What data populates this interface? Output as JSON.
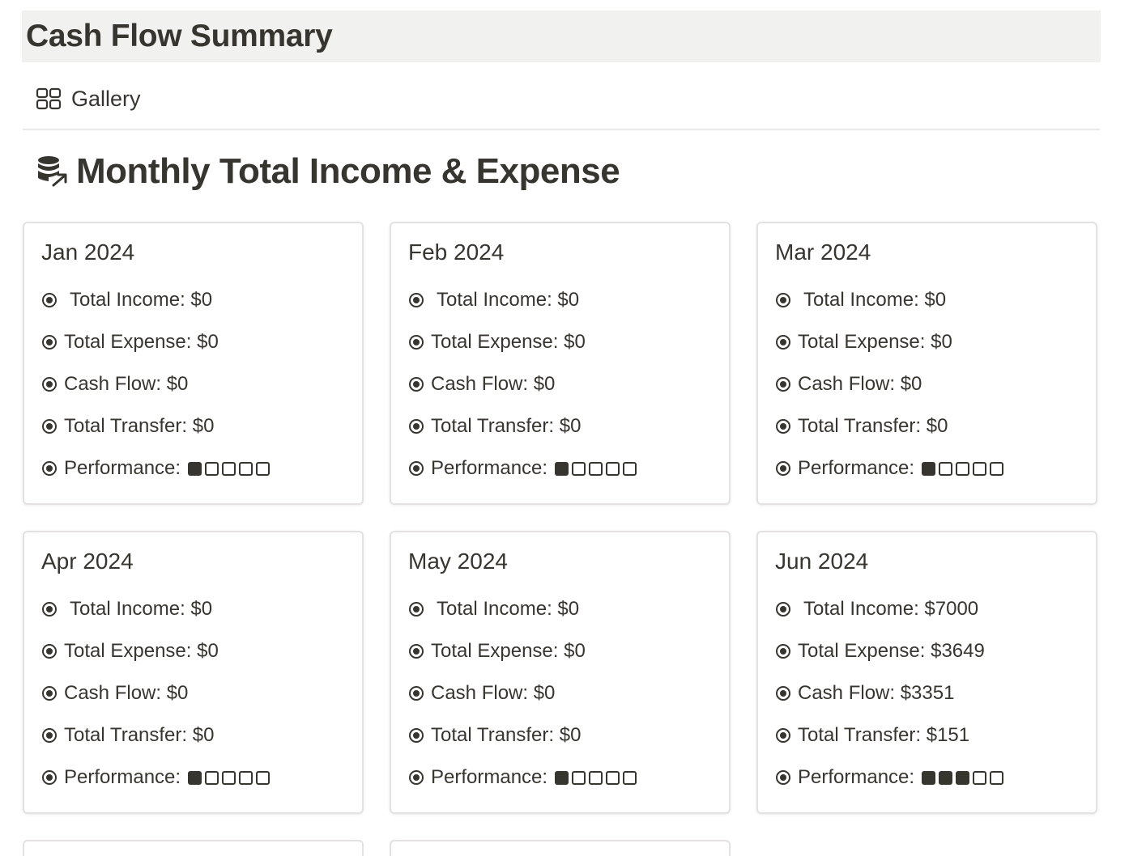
{
  "page": {
    "title": "Cash Flow Summary"
  },
  "view_tab": {
    "label": "Gallery",
    "icon": "gallery-grid-icon"
  },
  "section": {
    "title": "Monthly Total Income & Expense",
    "icon": "database-arrow-icon"
  },
  "field_labels": {
    "income": "Total Income: ",
    "expense": "Total Expense: ",
    "cash_flow": "Cash Flow: ",
    "transfer": "Total Transfer: ",
    "performance": "Performance:"
  },
  "cards": [
    {
      "title": "Jan 2024",
      "income": "$0",
      "expense": "$0",
      "cash_flow": "$0",
      "transfer": "$0",
      "performance_filled": 1,
      "performance_total": 5
    },
    {
      "title": "Feb 2024",
      "income": "$0",
      "expense": "$0",
      "cash_flow": "$0",
      "transfer": "$0",
      "performance_filled": 1,
      "performance_total": 5
    },
    {
      "title": "Mar 2024",
      "income": "$0",
      "expense": "$0",
      "cash_flow": "$0",
      "transfer": "$0",
      "performance_filled": 1,
      "performance_total": 5
    },
    {
      "title": "Apr 2024",
      "income": "$0",
      "expense": "$0",
      "cash_flow": "$0",
      "transfer": "$0",
      "performance_filled": 1,
      "performance_total": 5
    },
    {
      "title": "May 2024",
      "income": "$0",
      "expense": "$0",
      "cash_flow": "$0",
      "transfer": "$0",
      "performance_filled": 1,
      "performance_total": 5
    },
    {
      "title": "Jun 2024",
      "income": "$7000",
      "expense": "$3649",
      "cash_flow": "$3351",
      "transfer": "$151",
      "performance_filled": 3,
      "performance_total": 5
    }
  ],
  "colors": {
    "text": "#37352f",
    "title_bar_bg": "#f1f1ef",
    "card_border": "#e3e2e0"
  }
}
